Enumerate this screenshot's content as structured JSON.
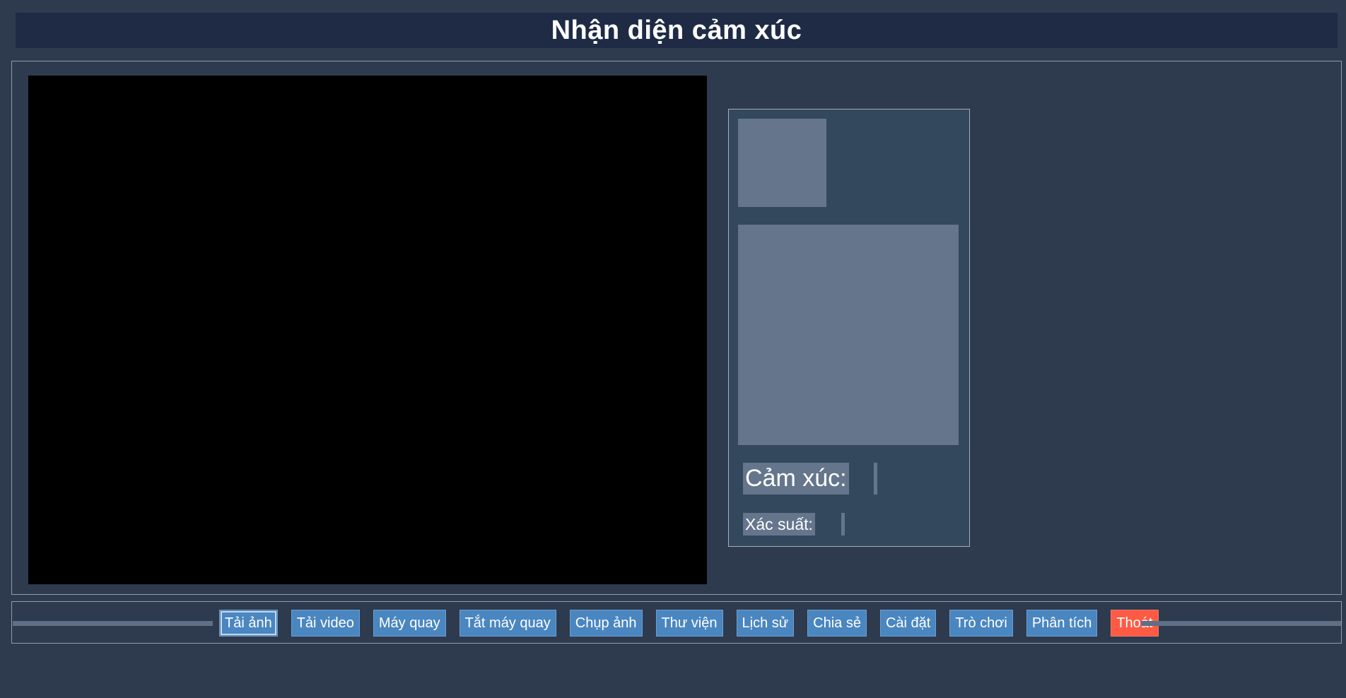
{
  "app": {
    "title": "Nhận diện cảm xúc"
  },
  "results": {
    "emotion_label": "Cảm xúc:",
    "emotion_value": "",
    "probability_label": "Xác suất:",
    "probability_value": ""
  },
  "toolbar": {
    "buttons": [
      {
        "label": "Tải ảnh",
        "focused": true
      },
      {
        "label": "Tải video"
      },
      {
        "label": "Máy quay"
      },
      {
        "label": "Tắt máy quay"
      },
      {
        "label": "Chụp ảnh"
      },
      {
        "label": "Thư viện"
      },
      {
        "label": "Lịch sử"
      },
      {
        "label": "Chia sẻ"
      },
      {
        "label": "Cài đặt"
      },
      {
        "label": "Trò chơi"
      },
      {
        "label": "Phân tích"
      },
      {
        "label": "Thoát",
        "variant": "danger"
      }
    ]
  },
  "colors": {
    "background": "#2e3a4e",
    "title_bar": "#1f2b45",
    "video_area": "#000000",
    "panel": "#33475d",
    "placeholder": "#65768c",
    "button": "#4a86c0",
    "exit_button": "#ff5a44"
  }
}
